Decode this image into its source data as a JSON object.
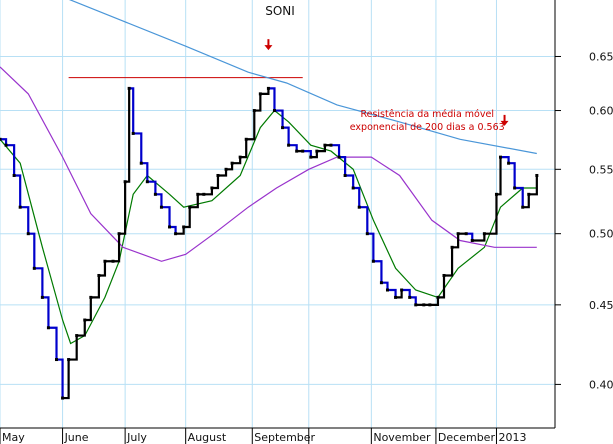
{
  "chart_data": {
    "type": "line",
    "title": "SONI",
    "xlabel": "",
    "ylabel": "",
    "y_scale": "log",
    "ylim": [
      0.375,
      0.68
    ],
    "yticks": [
      0.4,
      0.45,
      0.5,
      0.55,
      0.6,
      0.65
    ],
    "ytick_labels": [
      "0.40",
      "0.45",
      "0.50",
      "0.55",
      "0.60",
      "0.65"
    ],
    "xlim": [
      "2012-05-01",
      "2013-01-31"
    ],
    "month_ticks": [
      {
        "date": "2012-05-01",
        "label": "May"
      },
      {
        "date": "2012-06-01",
        "label": "June"
      },
      {
        "date": "2012-07-02",
        "label": "July"
      },
      {
        "date": "2012-08-01",
        "label": "August"
      },
      {
        "date": "2012-09-03",
        "label": "September"
      },
      {
        "date": "2012-10-01",
        "label": ""
      },
      {
        "date": "2012-11-01",
        "label": "November"
      },
      {
        "date": "2012-12-03",
        "label": "December"
      },
      {
        "date": "2013-01-02",
        "label": "2013"
      }
    ],
    "grid": true,
    "legend": "none",
    "colors": {
      "price_up": "#000000",
      "price_down": "#0000cc",
      "ema_short": "#007a00",
      "ema_medium": "#9933cc",
      "ema_200": "#4a96d8",
      "annotation": "#cc0000"
    },
    "series": [
      {
        "style": "price",
        "values": [
          {
            "x": "2012-05-01",
            "y": 0.575
          },
          {
            "x": "2012-05-04",
            "y": 0.57
          },
          {
            "x": "2012-05-08",
            "y": 0.545
          },
          {
            "x": "2012-05-11",
            "y": 0.52
          },
          {
            "x": "2012-05-15",
            "y": 0.5
          },
          {
            "x": "2012-05-18",
            "y": 0.475
          },
          {
            "x": "2012-05-22",
            "y": 0.455
          },
          {
            "x": "2012-05-25",
            "y": 0.435
          },
          {
            "x": "2012-05-29",
            "y": 0.415
          },
          {
            "x": "2012-06-01",
            "y": 0.392
          },
          {
            "x": "2012-06-04",
            "y": 0.415
          },
          {
            "x": "2012-06-08",
            "y": 0.43
          },
          {
            "x": "2012-06-12",
            "y": 0.44
          },
          {
            "x": "2012-06-15",
            "y": 0.455
          },
          {
            "x": "2012-06-19",
            "y": 0.47
          },
          {
            "x": "2012-06-22",
            "y": 0.48
          },
          {
            "x": "2012-06-26",
            "y": 0.48
          },
          {
            "x": "2012-06-29",
            "y": 0.5
          },
          {
            "x": "2012-07-02",
            "y": 0.54
          },
          {
            "x": "2012-07-04",
            "y": 0.62
          },
          {
            "x": "2012-07-06",
            "y": 0.58
          },
          {
            "x": "2012-07-10",
            "y": 0.555
          },
          {
            "x": "2012-07-13",
            "y": 0.54
          },
          {
            "x": "2012-07-17",
            "y": 0.53
          },
          {
            "x": "2012-07-20",
            "y": 0.52
          },
          {
            "x": "2012-07-24",
            "y": 0.505
          },
          {
            "x": "2012-07-27",
            "y": 0.5
          },
          {
            "x": "2012-07-31",
            "y": 0.505
          },
          {
            "x": "2012-08-03",
            "y": 0.52
          },
          {
            "x": "2012-08-07",
            "y": 0.53
          },
          {
            "x": "2012-08-10",
            "y": 0.53
          },
          {
            "x": "2012-08-14",
            "y": 0.535
          },
          {
            "x": "2012-08-17",
            "y": 0.545
          },
          {
            "x": "2012-08-21",
            "y": 0.55
          },
          {
            "x": "2012-08-24",
            "y": 0.555
          },
          {
            "x": "2012-08-28",
            "y": 0.56
          },
          {
            "x": "2012-08-31",
            "y": 0.575
          },
          {
            "x": "2012-09-04",
            "y": 0.6
          },
          {
            "x": "2012-09-07",
            "y": 0.615
          },
          {
            "x": "2012-09-11",
            "y": 0.62
          },
          {
            "x": "2012-09-14",
            "y": 0.6
          },
          {
            "x": "2012-09-18",
            "y": 0.585
          },
          {
            "x": "2012-09-21",
            "y": 0.57
          },
          {
            "x": "2012-09-25",
            "y": 0.565
          },
          {
            "x": "2012-09-28",
            "y": 0.565
          },
          {
            "x": "2012-10-02",
            "y": 0.56
          },
          {
            "x": "2012-10-05",
            "y": 0.565
          },
          {
            "x": "2012-10-09",
            "y": 0.57
          },
          {
            "x": "2012-10-12",
            "y": 0.57
          },
          {
            "x": "2012-10-16",
            "y": 0.56
          },
          {
            "x": "2012-10-19",
            "y": 0.545
          },
          {
            "x": "2012-10-23",
            "y": 0.535
          },
          {
            "x": "2012-10-26",
            "y": 0.52
          },
          {
            "x": "2012-10-30",
            "y": 0.5
          },
          {
            "x": "2012-11-02",
            "y": 0.48
          },
          {
            "x": "2012-11-06",
            "y": 0.465
          },
          {
            "x": "2012-11-09",
            "y": 0.46
          },
          {
            "x": "2012-11-13",
            "y": 0.455
          },
          {
            "x": "2012-11-16",
            "y": 0.46
          },
          {
            "x": "2012-11-20",
            "y": 0.455
          },
          {
            "x": "2012-11-23",
            "y": 0.45
          },
          {
            "x": "2012-11-27",
            "y": 0.45
          },
          {
            "x": "2012-11-30",
            "y": 0.45
          },
          {
            "x": "2012-12-04",
            "y": 0.455
          },
          {
            "x": "2012-12-07",
            "y": 0.47
          },
          {
            "x": "2012-12-11",
            "y": 0.49
          },
          {
            "x": "2012-12-14",
            "y": 0.5
          },
          {
            "x": "2012-12-18",
            "y": 0.5
          },
          {
            "x": "2012-12-21",
            "y": 0.495
          },
          {
            "x": "2012-12-27",
            "y": 0.5
          },
          {
            "x": "2013-01-02",
            "y": 0.53
          },
          {
            "x": "2013-01-04",
            "y": 0.56
          },
          {
            "x": "2013-01-08",
            "y": 0.555
          },
          {
            "x": "2013-01-11",
            "y": 0.535
          },
          {
            "x": "2013-01-15",
            "y": 0.52
          },
          {
            "x": "2013-01-18",
            "y": 0.53
          },
          {
            "x": "2013-01-22",
            "y": 0.545
          }
        ]
      },
      {
        "style": "ema_short",
        "values": [
          {
            "x": "2012-05-01",
            "y": 0.575
          },
          {
            "x": "2012-05-11",
            "y": 0.555
          },
          {
            "x": "2012-05-22",
            "y": 0.49
          },
          {
            "x": "2012-06-01",
            "y": 0.44
          },
          {
            "x": "2012-06-05",
            "y": 0.425
          },
          {
            "x": "2012-06-12",
            "y": 0.43
          },
          {
            "x": "2012-06-22",
            "y": 0.455
          },
          {
            "x": "2012-06-29",
            "y": 0.48
          },
          {
            "x": "2012-07-06",
            "y": 0.53
          },
          {
            "x": "2012-07-13",
            "y": 0.545
          },
          {
            "x": "2012-07-24",
            "y": 0.53
          },
          {
            "x": "2012-07-31",
            "y": 0.52
          },
          {
            "x": "2012-08-14",
            "y": 0.525
          },
          {
            "x": "2012-08-28",
            "y": 0.545
          },
          {
            "x": "2012-09-07",
            "y": 0.585
          },
          {
            "x": "2012-09-14",
            "y": 0.6
          },
          {
            "x": "2012-09-21",
            "y": 0.59
          },
          {
            "x": "2012-10-02",
            "y": 0.57
          },
          {
            "x": "2012-10-12",
            "y": 0.565
          },
          {
            "x": "2012-10-23",
            "y": 0.55
          },
          {
            "x": "2012-11-02",
            "y": 0.51
          },
          {
            "x": "2012-11-13",
            "y": 0.475
          },
          {
            "x": "2012-11-23",
            "y": 0.46
          },
          {
            "x": "2012-12-04",
            "y": 0.455
          },
          {
            "x": "2012-12-14",
            "y": 0.475
          },
          {
            "x": "2012-12-27",
            "y": 0.49
          },
          {
            "x": "2013-01-04",
            "y": 0.52
          },
          {
            "x": "2013-01-15",
            "y": 0.535
          },
          {
            "x": "2013-01-22",
            "y": 0.535
          }
        ]
      },
      {
        "style": "ema_medium",
        "values": [
          {
            "x": "2012-05-01",
            "y": 0.64
          },
          {
            "x": "2012-05-15",
            "y": 0.615
          },
          {
            "x": "2012-06-01",
            "y": 0.56
          },
          {
            "x": "2012-06-15",
            "y": 0.515
          },
          {
            "x": "2012-07-01",
            "y": 0.49
          },
          {
            "x": "2012-07-20",
            "y": 0.48
          },
          {
            "x": "2012-08-01",
            "y": 0.485
          },
          {
            "x": "2012-08-15",
            "y": 0.5
          },
          {
            "x": "2012-09-01",
            "y": 0.52
          },
          {
            "x": "2012-09-15",
            "y": 0.535
          },
          {
            "x": "2012-10-01",
            "y": 0.55
          },
          {
            "x": "2012-10-15",
            "y": 0.56
          },
          {
            "x": "2012-11-01",
            "y": 0.56
          },
          {
            "x": "2012-11-15",
            "y": 0.545
          },
          {
            "x": "2012-12-01",
            "y": 0.51
          },
          {
            "x": "2012-12-15",
            "y": 0.495
          },
          {
            "x": "2013-01-01",
            "y": 0.49
          },
          {
            "x": "2013-01-22",
            "y": 0.49
          }
        ]
      },
      {
        "style": "ema_200",
        "values": [
          {
            "x": "2012-05-01",
            "y": 0.73
          },
          {
            "x": "2012-06-01",
            "y": 0.71
          },
          {
            "x": "2012-07-01",
            "y": 0.685
          },
          {
            "x": "2012-08-01",
            "y": 0.66
          },
          {
            "x": "2012-09-01",
            "y": 0.635
          },
          {
            "x": "2012-09-20",
            "y": 0.625
          },
          {
            "x": "2012-10-15",
            "y": 0.605
          },
          {
            "x": "2012-11-15",
            "y": 0.59
          },
          {
            "x": "2012-12-15",
            "y": 0.575
          },
          {
            "x": "2013-01-22",
            "y": 0.563
          }
        ]
      }
    ],
    "reference_lines": [
      {
        "type": "horizontal",
        "y": 0.63,
        "x_start": "2012-06-04",
        "x_end": "2012-09-28",
        "color": "#cc0000"
      }
    ],
    "markers": [
      {
        "type": "arrow-down",
        "x": "2012-09-11",
        "y": 0.66,
        "color": "#cc0000"
      },
      {
        "type": "arrow-down",
        "x": "2013-01-06",
        "y": 0.59,
        "color": "#cc0000"
      }
    ],
    "annotations": [
      {
        "line1": "Resistência da média móvel",
        "line2": "exponencial de 200 dias a 0.563",
        "x": "2012-10-25"
      }
    ]
  }
}
